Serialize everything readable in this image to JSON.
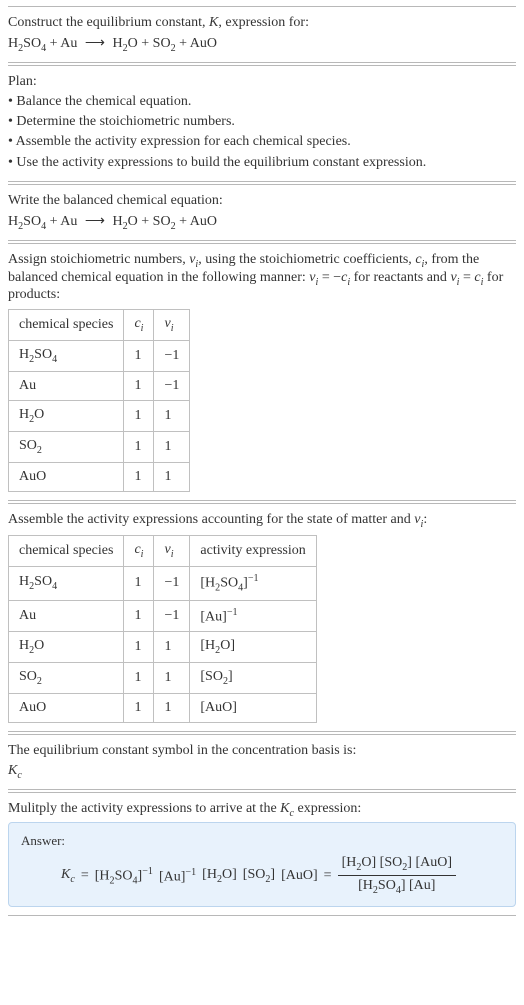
{
  "chart_data": [
    {
      "type": "table",
      "title": "Stoichiometric numbers",
      "columns": [
        "chemical species",
        "c_i",
        "ν_i"
      ],
      "rows": [
        [
          "H2SO4",
          1,
          -1
        ],
        [
          "Au",
          1,
          -1
        ],
        [
          "H2O",
          1,
          1
        ],
        [
          "SO2",
          1,
          1
        ],
        [
          "AuO",
          1,
          1
        ]
      ]
    },
    {
      "type": "table",
      "title": "Activity expressions",
      "columns": [
        "chemical species",
        "c_i",
        "ν_i",
        "activity expression"
      ],
      "rows": [
        [
          "H2SO4",
          1,
          -1,
          "[H2SO4]^-1"
        ],
        [
          "Au",
          1,
          -1,
          "[Au]^-1"
        ],
        [
          "H2O",
          1,
          1,
          "[H2O]"
        ],
        [
          "SO2",
          1,
          1,
          "[SO2]"
        ],
        [
          "AuO",
          1,
          1,
          "[AuO]"
        ]
      ]
    }
  ],
  "intro": {
    "line1": "Construct the equilibrium constant, ",
    "line1b": ", expression for:",
    "k": "K"
  },
  "reaction": {
    "r1": "H",
    "r2": "SO",
    "plus": " + ",
    "au": "Au",
    "arrow": "⟶",
    "h2o": "H",
    "o": "O",
    "so2": "SO",
    "auo": "AuO"
  },
  "plan": {
    "title": "Plan:",
    "b1": "• Balance the chemical equation.",
    "b2": "• Determine the stoichiometric numbers.",
    "b3": "• Assemble the activity expression for each chemical species.",
    "b4": "• Use the activity expressions to build the equilibrium constant expression."
  },
  "balanced_title": "Write the balanced chemical equation:",
  "stoich_intro_a": "Assign stoichiometric numbers, ",
  "stoich_intro_b": ", using the stoichiometric coefficients, ",
  "stoich_intro_c": ", from the balanced chemical equation in the following manner: ",
  "stoich_intro_d": " for reactants and ",
  "stoich_intro_e": " for products:",
  "nu_i": "ν",
  "c_i": "c",
  "eq1": " = −",
  "eq2": " = ",
  "t1": {
    "h_species": "chemical species",
    "h_ci": "c",
    "h_nu": "ν",
    "r": [
      {
        "sp": "H",
        "ci": "1",
        "nu": "−1"
      },
      {
        "sp": "Au",
        "ci": "1",
        "nu": "−1"
      },
      {
        "sp": "H",
        "ci": "1",
        "nu": "1"
      },
      {
        "sp": "SO",
        "ci": "1",
        "nu": "1"
      },
      {
        "sp": "AuO",
        "ci": "1",
        "nu": "1"
      }
    ]
  },
  "activity_intro_a": "Assemble the activity expressions accounting for the state of matter and ",
  "activity_intro_b": ":",
  "t2": {
    "h_species": "chemical species",
    "h_ci": "c",
    "h_nu": "ν",
    "h_act": "activity expression",
    "r": [
      {
        "sp": "H",
        "ci": "1",
        "nu": "−1"
      },
      {
        "sp": "Au",
        "ci": "1",
        "nu": "−1"
      },
      {
        "sp": "H",
        "ci": "1",
        "nu": "1"
      },
      {
        "sp": "SO",
        "ci": "1",
        "nu": "1"
      },
      {
        "sp": "AuO",
        "ci": "1",
        "nu": "1"
      }
    ]
  },
  "eq_symbol_line": "The equilibrium constant symbol in the concentration basis is:",
  "kc": "K",
  "kc_sub": "c",
  "multiply_line_a": "Mulitply the activity expressions to arrive at the ",
  "multiply_line_b": " expression:",
  "answer_label": "Answer:",
  "ans": {
    "eq": " = ",
    "open": "[",
    "close": "]",
    "neg1": "−1",
    "sp_h2so4_a": "H",
    "sp_h2so4_b": "SO",
    "sp_au": "Au",
    "sp_h2o_a": "H",
    "sp_h2o_b": "O",
    "sp_so2": "SO",
    "sp_auo": "AuO"
  }
}
